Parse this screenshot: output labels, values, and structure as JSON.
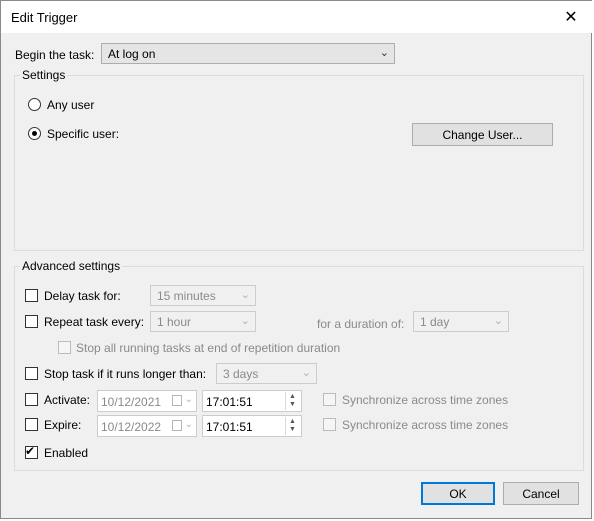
{
  "window": {
    "title": "Edit Trigger"
  },
  "begin": {
    "label": "Begin the task:",
    "value": "At log on"
  },
  "settings": {
    "legend": "Settings",
    "any_user": "Any user",
    "specific_user": "Specific user:",
    "change_user_button": "Change User..."
  },
  "advanced": {
    "legend": "Advanced settings",
    "delay": {
      "label": "Delay task for:",
      "value": "15 minutes",
      "checked": false
    },
    "repeat": {
      "label": "Repeat task every:",
      "value": "1 hour",
      "duration_label": "for a duration of:",
      "duration_value": "1 day",
      "checked": false
    },
    "stop_all": {
      "label": "Stop all running tasks at end of repetition duration",
      "checked": false
    },
    "stop_longer": {
      "label": "Stop task if it runs longer than:",
      "value": "3 days",
      "checked": false
    },
    "activate": {
      "label": "Activate:",
      "date": "10/12/2021",
      "time": "17:01:51",
      "sync_label": "Synchronize across time zones",
      "checked": false
    },
    "expire": {
      "label": "Expire:",
      "date": "10/12/2022",
      "time": "17:01:51",
      "sync_label": "Synchronize across time zones",
      "checked": false
    },
    "enabled": {
      "label": "Enabled",
      "checked": true
    }
  },
  "buttons": {
    "ok": "OK",
    "cancel": "Cancel"
  },
  "colors": {
    "dialog_bg": "#f0f0f0",
    "accent": "#0078d7",
    "disabled_text": "#8a8a8a"
  }
}
